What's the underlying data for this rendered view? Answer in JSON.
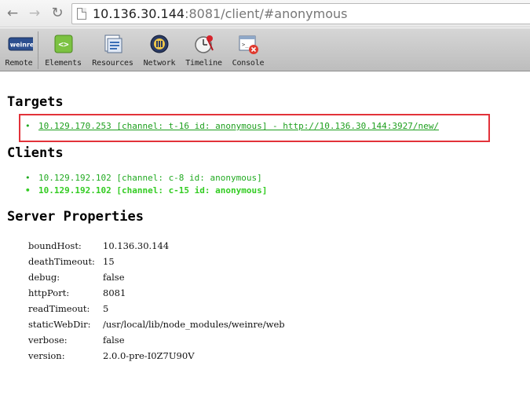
{
  "browser": {
    "url_host": "10.136.30.144",
    "url_rest": ":8081/client/#anonymous"
  },
  "toolbar": {
    "items": [
      {
        "label": "Remote",
        "icon": "weinre-logo-icon"
      },
      {
        "label": "Elements",
        "icon": "elements-icon"
      },
      {
        "label": "Resources",
        "icon": "resources-icon"
      },
      {
        "label": "Network",
        "icon": "network-icon"
      },
      {
        "label": "Timeline",
        "icon": "timeline-icon"
      },
      {
        "label": "Console",
        "icon": "console-icon"
      }
    ],
    "logo_text": "weinre"
  },
  "targets": {
    "title": "Targets",
    "items": [
      "10.129.170.253 [channel: t-16 id: anonymous] - http://10.136.30.144:3927/new/"
    ]
  },
  "clients": {
    "title": "Clients",
    "items": [
      "10.129.192.102 [channel: c-8 id: anonymous]",
      "10.129.192.102 [channel: c-15 id: anonymous]"
    ]
  },
  "server_properties": {
    "title": "Server Properties",
    "rows": [
      {
        "key": "boundHost:",
        "value": "10.136.30.144"
      },
      {
        "key": "deathTimeout:",
        "value": "15"
      },
      {
        "key": "debug:",
        "value": "false"
      },
      {
        "key": "httpPort:",
        "value": "8081"
      },
      {
        "key": "readTimeout:",
        "value": "5"
      },
      {
        "key": "staticWebDir:",
        "value": "/usr/local/lib/node_modules/weinre/web"
      },
      {
        "key": "verbose:",
        "value": "false"
      },
      {
        "key": "version:",
        "value": "2.0.0-pre-I0Z7U90V"
      }
    ]
  },
  "colors": {
    "link_green": "#1d9f1d",
    "highlight_red": "#e2323a"
  }
}
